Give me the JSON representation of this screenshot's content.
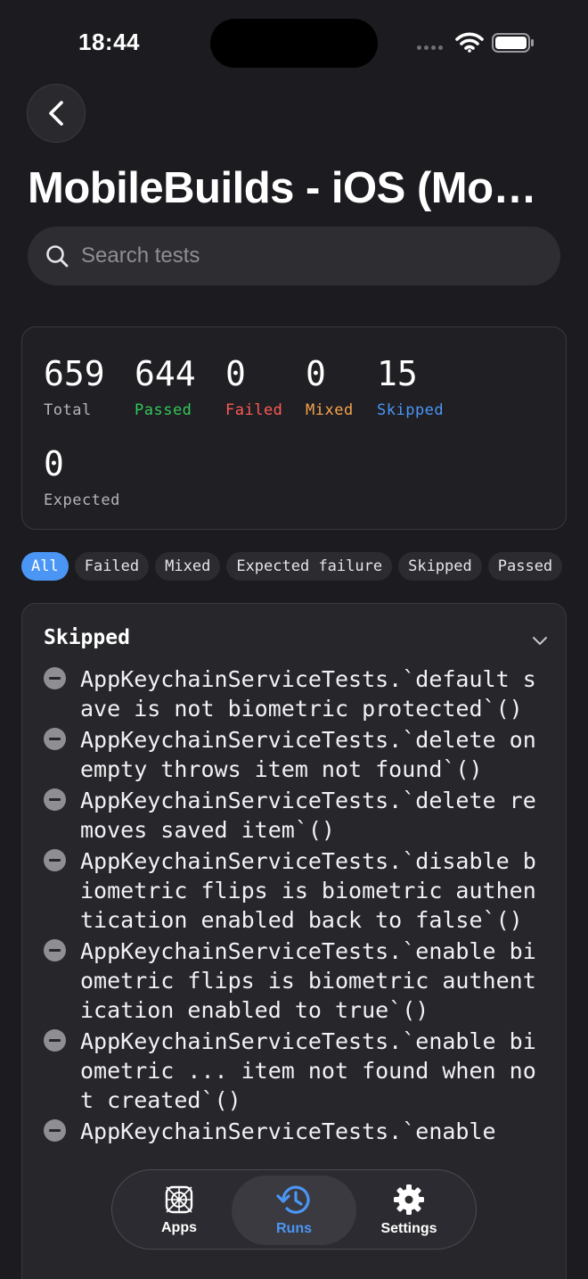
{
  "status_bar": {
    "time": "18:44"
  },
  "header": {
    "title": "MobileBuilds - iOS (MobileBuilds)"
  },
  "search": {
    "placeholder": "Search tests",
    "value": ""
  },
  "summary": [
    {
      "value": "659",
      "label": "Total",
      "color": "#b5b5ba"
    },
    {
      "value": "644",
      "label": "Passed",
      "color": "#34c759"
    },
    {
      "value": "0",
      "label": "Failed",
      "color": "#ff5a55"
    },
    {
      "value": "0",
      "label": "Mixed",
      "color": "#f5a44a"
    },
    {
      "value": "15",
      "label": "Skipped",
      "color": "#4b96f5"
    },
    {
      "value": "0",
      "label": "Expected",
      "color": "#b5b5ba"
    }
  ],
  "filters": {
    "selected": "All",
    "items": [
      "All",
      "Failed",
      "Mixed",
      "Expected failure",
      "Skipped",
      "Passed"
    ]
  },
  "section": {
    "title": "Skipped",
    "tests": [
      "AppKeychainServiceTests.`default save is not biometric protected`()",
      "AppKeychainServiceTests.`delete on empty throws item not found`()",
      "AppKeychainServiceTests.`delete removes saved item`()",
      "AppKeychainServiceTests.`disable biometric flips is biometric authentication enabled back to false`()",
      "AppKeychainServiceTests.`enable biometric flips is biometric authentication enabled to true`()",
      "AppKeychainServiceTests.`enable biometric ... item not found when not created`()",
      "AppKeychainServiceTests.`enable"
    ]
  },
  "tabbar": {
    "items": [
      {
        "label": "Apps",
        "icon": "apps-icon"
      },
      {
        "label": "Runs",
        "icon": "runs-history-icon"
      },
      {
        "label": "Settings",
        "icon": "gear-icon"
      }
    ],
    "active": "Runs",
    "active_color": "#4b96f5"
  }
}
